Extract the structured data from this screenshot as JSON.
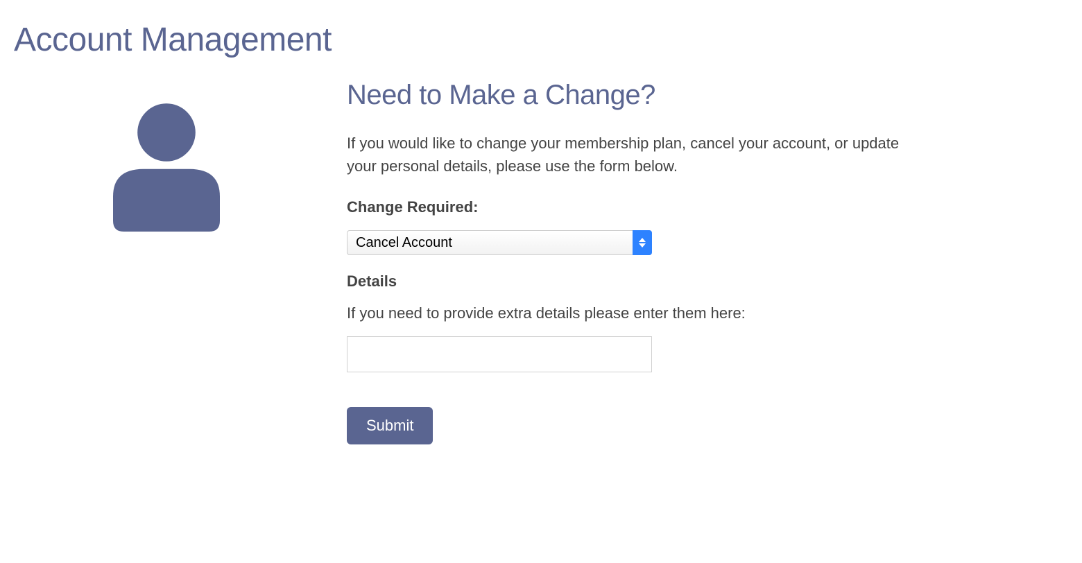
{
  "page": {
    "title": "Account Management"
  },
  "section": {
    "heading": "Need to Make a Change?",
    "description": "If you would like to change your membership plan, cancel your account, or update your personal details, please use the form below."
  },
  "form": {
    "change_required_label": "Change Required:",
    "change_required_selected": "Cancel Account",
    "details_label": "Details",
    "details_hint": "If you need to provide extra details please enter them here:",
    "details_value": "",
    "submit_label": "Submit"
  },
  "colors": {
    "accent": "#5a6591",
    "select_button": "#2d82ff",
    "text_dark": "#444444"
  }
}
